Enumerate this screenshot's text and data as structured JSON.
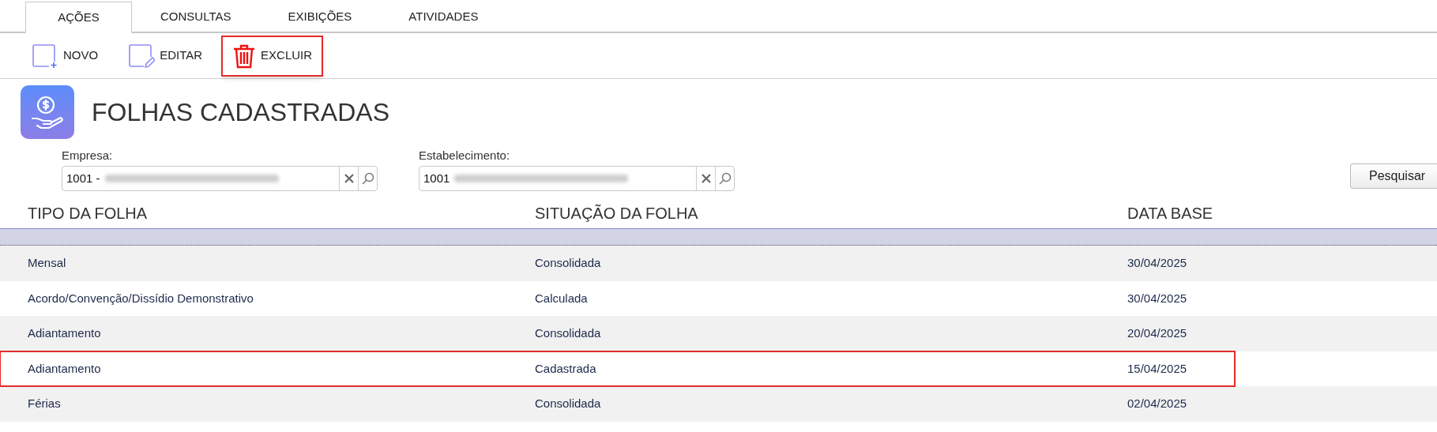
{
  "tabs": [
    {
      "label": "AÇÕES",
      "selected": true
    },
    {
      "label": "CONSULTAS",
      "selected": false
    },
    {
      "label": "EXIBIÇÕES",
      "selected": false
    },
    {
      "label": "ATIVIDADES",
      "selected": false
    }
  ],
  "toolbar": [
    {
      "kind": "new",
      "label": "NOVO",
      "highlighted": false
    },
    {
      "kind": "edit",
      "label": "EDITAR",
      "highlighted": false
    },
    {
      "kind": "delete",
      "label": "EXCLUIR",
      "highlighted": true
    }
  ],
  "page_title": "FOLHAS CADASTRADAS",
  "filters": [
    {
      "label": "Empresa:",
      "value": "1001 -"
    },
    {
      "label": "Estabelecimento:",
      "value": "1001"
    }
  ],
  "search_button": "Pesquisar",
  "table": {
    "columns": [
      "TIPO DA FOLHA",
      "SITUAÇÃO DA FOLHA",
      "DATA BASE"
    ],
    "rows": [
      {
        "selected": true,
        "highlighted": false
      },
      {
        "cells": [
          "Mensal",
          "Consolidada",
          "30/04/2025"
        ],
        "selected": false,
        "highlighted": false
      },
      {
        "cells": [
          "Acordo/Convenção/Dissídio Demonstrativo",
          "Calculada",
          "30/04/2025"
        ],
        "selected": false,
        "highlighted": false
      },
      {
        "cells": [
          "Adiantamento",
          "Consolidada",
          "20/04/2025"
        ],
        "selected": false,
        "highlighted": false
      },
      {
        "cells": [
          "Adiantamento",
          "Cadastrada",
          "15/04/2025"
        ],
        "selected": false,
        "highlighted": true
      },
      {
        "cells": [
          "Férias",
          "Consolidada",
          "02/04/2025"
        ],
        "selected": false,
        "highlighted": false
      }
    ]
  }
}
